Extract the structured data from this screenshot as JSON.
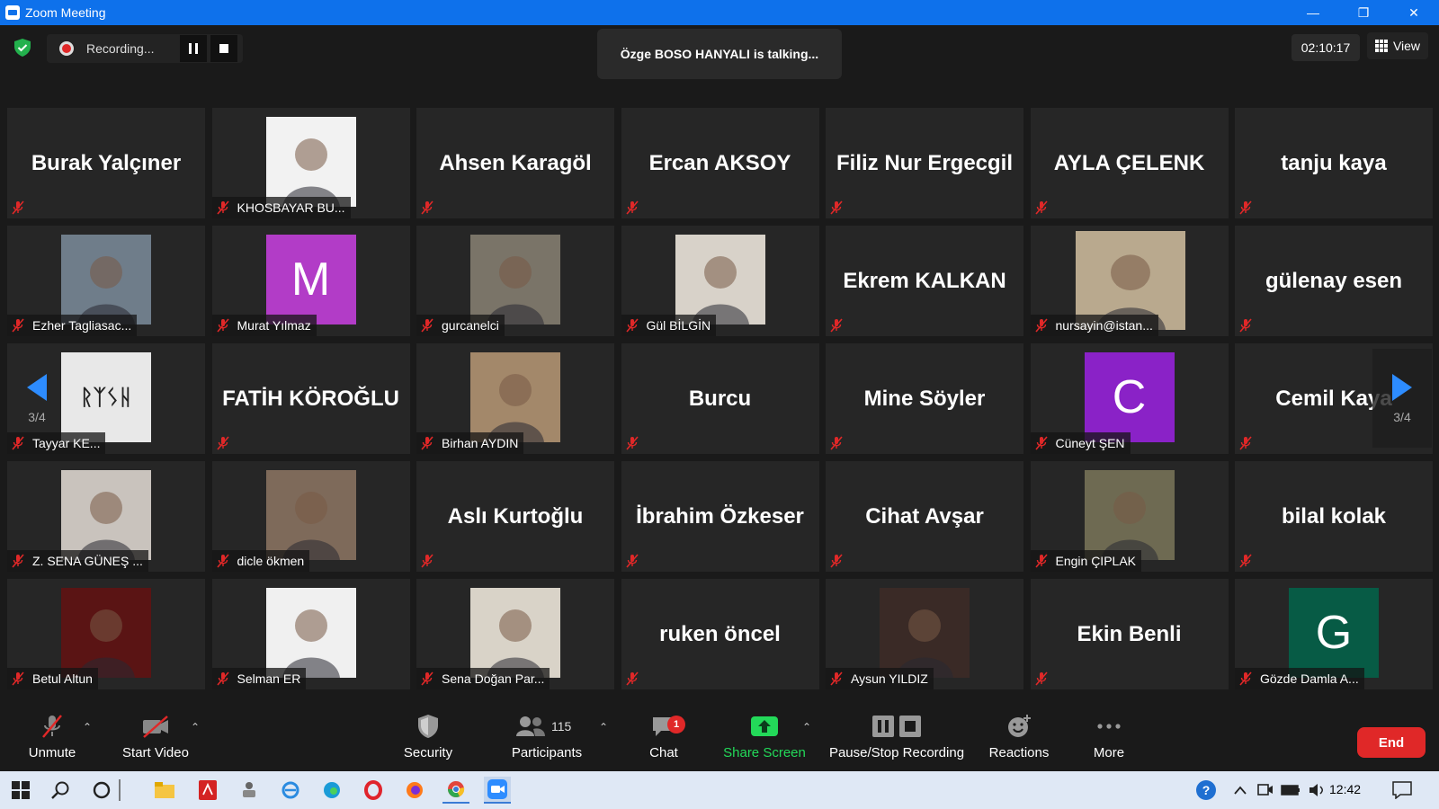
{
  "window": {
    "title": "Zoom Meeting",
    "minimize": "—",
    "restore": "❐",
    "close": "✕"
  },
  "top": {
    "recording_label": "Recording...",
    "talking": "Özge BOSO HANYALI is talking...",
    "timer": "02:10:17",
    "view_label": "View"
  },
  "nav": {
    "page_left": "3/4",
    "page_right": "3/4"
  },
  "tiles": [
    {
      "type": "name",
      "name": "Burak Yalçıner"
    },
    {
      "type": "photo",
      "label": "KHOSBAYAR BU...",
      "bg": "#f2f2f2"
    },
    {
      "type": "name",
      "name": "Ahsen Karagöl"
    },
    {
      "type": "name",
      "name": "Ercan AKSOY"
    },
    {
      "type": "name",
      "name": "Filiz Nur Ergecgil"
    },
    {
      "type": "name",
      "name": "AYLA ÇELENK"
    },
    {
      "type": "name",
      "name": "tanju kaya"
    },
    {
      "type": "photo",
      "label": "Ezher Tagliasac...",
      "bg": "#6f7d8a"
    },
    {
      "type": "avatar",
      "letter": "M",
      "label": "Murat Yılmaz",
      "color": "#b23cc7"
    },
    {
      "type": "photo",
      "label": "gurcanelci",
      "bg": "#7a7468"
    },
    {
      "type": "photo",
      "label": "Gül BİLGİN",
      "bg": "#d8d2c9"
    },
    {
      "type": "name",
      "name": "Ekrem  KALKAN"
    },
    {
      "type": "photo",
      "label": "nursayin@istan...",
      "bg": "#b9a98e",
      "wide": true
    },
    {
      "type": "name",
      "name": "gülenay esen"
    },
    {
      "type": "photo",
      "label": "Tayyar KE...",
      "bg": "#e8e8e8",
      "rune": "ᚱᛉᛊᚺ"
    },
    {
      "type": "name",
      "name": "FATİH KÖROĞLU"
    },
    {
      "type": "photo",
      "label": "Birhan AYDIN",
      "bg": "#a3886a"
    },
    {
      "type": "name",
      "name": "Burcu"
    },
    {
      "type": "name",
      "name": "Mine Söyler"
    },
    {
      "type": "avatar",
      "letter": "C",
      "label": "Cüneyt ŞEN",
      "color": "#8a22c7"
    },
    {
      "type": "name",
      "name": "Cemil Kaya"
    },
    {
      "type": "photo",
      "label": "Z. SENA GÜNEŞ ...",
      "bg": "#c9c3bd"
    },
    {
      "type": "photo",
      "label": "dicle ökmen",
      "bg": "#7e6a5a"
    },
    {
      "type": "name",
      "name": "Aslı Kurtoğlu"
    },
    {
      "type": "name",
      "name": "İbrahim Özkeser"
    },
    {
      "type": "name",
      "name": "Cihat Avşar"
    },
    {
      "type": "photo",
      "label": "Engin ÇIPLAK",
      "bg": "#6e6a52"
    },
    {
      "type": "name",
      "name": "bilal kolak"
    },
    {
      "type": "photo",
      "label": "Betul Altun",
      "bg": "#5a1414"
    },
    {
      "type": "photo",
      "label": "Selman ER",
      "bg": "#f0f0f0"
    },
    {
      "type": "photo",
      "label": "Sena Doğan Par...",
      "bg": "#d9d3c8"
    },
    {
      "type": "name",
      "name": "ruken öncel"
    },
    {
      "type": "photo",
      "label": "Aysun YILDIZ",
      "bg": "#3a2a26"
    },
    {
      "type": "name",
      "name": "Ekin Benli"
    },
    {
      "type": "avatar",
      "letter": "G",
      "label": "Gözde Damla A...",
      "color": "#075b45"
    }
  ],
  "toolbar": {
    "unmute": "Unmute",
    "start_video": "Start Video",
    "security": "Security",
    "participants": "Participants",
    "participants_count": "115",
    "chat": "Chat",
    "chat_badge": "1",
    "share_screen": "Share Screen",
    "pause_stop": "Pause/Stop Recording",
    "reactions": "Reactions",
    "more": "More",
    "end": "End"
  },
  "taskbar": {
    "clock": "12:42"
  },
  "colors": {
    "accent": "#0e71eb",
    "share_green": "#23d959",
    "end_red": "#e02828",
    "muted_red": "#e02828"
  }
}
